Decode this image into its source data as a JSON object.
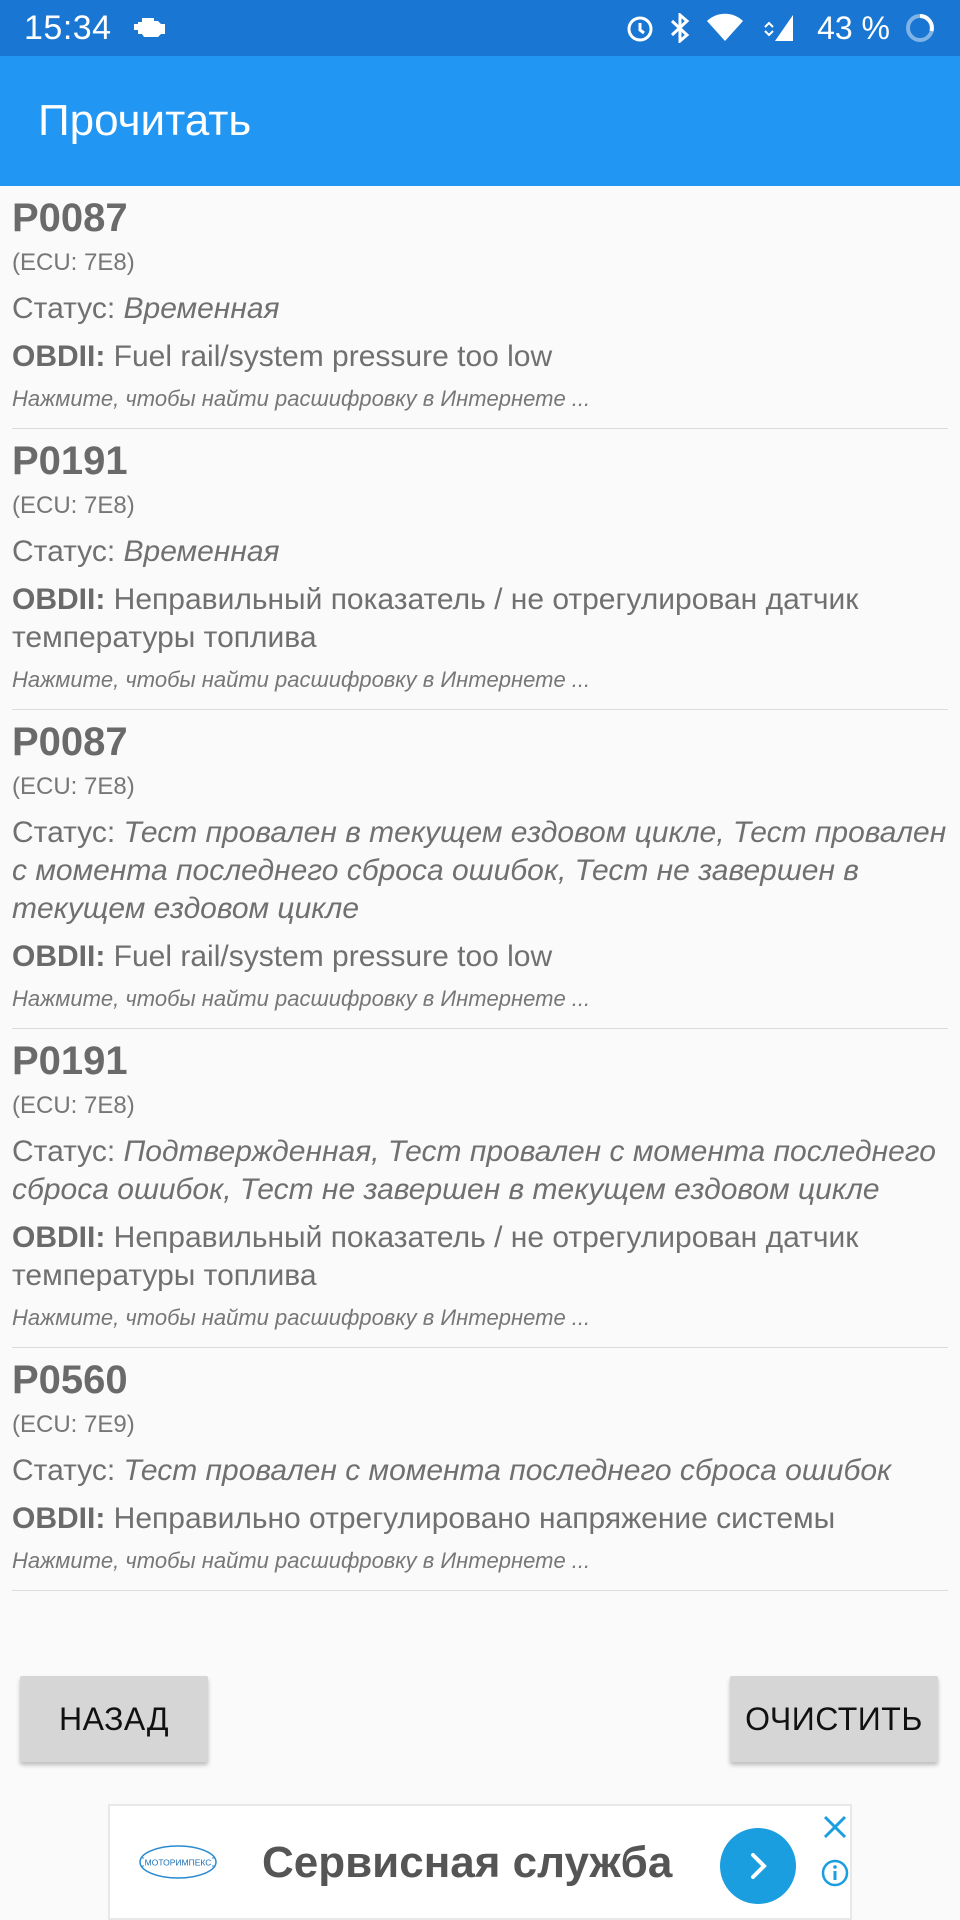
{
  "status_bar": {
    "time": "15:34",
    "battery_percent": "43 %",
    "icons": [
      "car-engine-icon",
      "alarm-icon",
      "bluetooth-icon",
      "wifi-icon",
      "signal-icon",
      "battery-icon"
    ]
  },
  "app_bar": {
    "title": "Прочитать"
  },
  "dtc_list": [
    {
      "code": "P0087",
      "ecu": "(ECU: 7E8)",
      "status_label": "Статус:",
      "status_value": "Временная",
      "obd_label": "OBDII:",
      "obd_desc": "Fuel rail/system pressure too low",
      "hint": "Нажмите, чтобы найти расшифровку в Интернете ..."
    },
    {
      "code": "P0191",
      "ecu": "(ECU: 7E8)",
      "status_label": "Статус:",
      "status_value": "Временная",
      "obd_label": "OBDII:",
      "obd_desc": "Неправильный показатель / не отрегулирован датчик температуры топлива",
      "hint": "Нажмите, чтобы найти расшифровку в Интернете ..."
    },
    {
      "code": "P0087",
      "ecu": "(ECU: 7E8)",
      "status_label": "Статус:",
      "status_value": "Тест провален в текущем ездовом цикле, Тест провален с момента последнего сброса ошибок, Тест не завершен в текущем ездовом цикле",
      "obd_label": "OBDII:",
      "obd_desc": "Fuel rail/system pressure too low",
      "hint": "Нажмите, чтобы найти расшифровку в Интернете ..."
    },
    {
      "code": "P0191",
      "ecu": "(ECU: 7E8)",
      "status_label": "Статус:",
      "status_value": "Подтвержденная, Тест провален с момента последнего сброса ошибок, Тест не завершен в текущем ездовом цикле",
      "obd_label": "OBDII:",
      "obd_desc": "Неправильный показатель / не отрегулирован датчик температуры топлива",
      "hint": "Нажмите, чтобы найти расшифровку в Интернете ..."
    },
    {
      "code": "P0560",
      "ecu": "(ECU: 7E9)",
      "status_label": "Статус:",
      "status_value": "Тест провален с момента последнего сброса ошибок",
      "obd_label": "OBDII:",
      "obd_desc": "Неправильно отрегулировано напряжение системы",
      "hint": "Нажмите, чтобы найти расшифровку в Интернете ..."
    }
  ],
  "buttons": {
    "back": "НАЗАД",
    "clear": "ОЧИСТИТЬ"
  },
  "ad": {
    "logo_text": "МОТОРИМПЕКС",
    "title": "Сервисная служба"
  },
  "colors": {
    "status_bar": "#1976d2",
    "app_bar": "#2196f3",
    "ad_arrow": "#1a9ee0"
  }
}
